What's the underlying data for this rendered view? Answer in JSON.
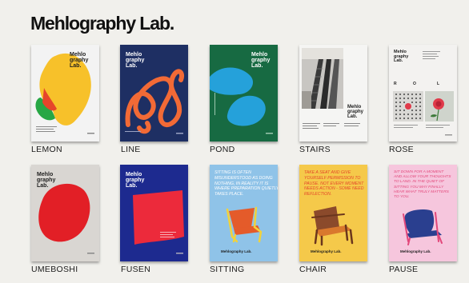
{
  "header": {
    "title": "Mehlography Lab."
  },
  "posters": [
    {
      "id": "lemon",
      "caption": "LEMON",
      "brand": "Mehlo\ngraphy\nLab.",
      "colors": {
        "bg": "#f3f3f3",
        "shape1": "#f7c12a",
        "shape2": "#e6452a",
        "shape3": "#27a745",
        "text": "#1e1e1e"
      }
    },
    {
      "id": "line",
      "caption": "LINE",
      "brand": "Mehlo\ngraphy\nLab.",
      "colors": {
        "bg": "#1e2f63",
        "shape1": "#f26a36",
        "text": "#ffffff"
      }
    },
    {
      "id": "pond",
      "caption": "POND",
      "brand": "Mehlo\ngraphy\nLab.",
      "colors": {
        "bg": "#176a42",
        "shape1": "#25a1da",
        "text": "#ffffff"
      }
    },
    {
      "id": "stairs",
      "caption": "STAIRS",
      "brand": "Mehlo\ngraphy\nLab.",
      "colors": {
        "bg": "#f5f5f3",
        "text": "#1e1e1e"
      }
    },
    {
      "id": "rose",
      "caption": "ROSE",
      "brand": "Mehlo\ngraphy\nLab.",
      "colors": {
        "bg": "#f3f2f0",
        "accent": "#e03a4a",
        "text": "#1e1e1e"
      }
    },
    {
      "id": "umeboshi",
      "caption": "UMEBOSHI",
      "brand": "Mehlo\ngraphy\nLab.",
      "colors": {
        "bg": "#d9d6d2",
        "shape1": "#e21f26",
        "text": "#1e1e1e"
      }
    },
    {
      "id": "fusen",
      "caption": "FUSEN",
      "brand": "Mehlo\ngraphy\nLab.",
      "colors": {
        "bg": "#1d2a8f",
        "shape1": "#ec2a3b",
        "text": "#ffffff"
      }
    },
    {
      "id": "sitting",
      "caption": "SITTING",
      "brand": "Mehlography Lab.",
      "text": "SITTING IS OFTEN\nMISUNDERSTOOD AS DOING\nNOTHING, IN REALITY IT IS\nWHERE PREPARATION QUIETLY\nTAKES PLACE.",
      "colors": {
        "bg": "#8fc3e8",
        "shape1": "#e45b2a",
        "shape2": "#f2d23a",
        "text": "#ffffff"
      }
    },
    {
      "id": "chair",
      "caption": "CHAIR",
      "brand": "Mehlography Lab.",
      "text": "TAKE A SEAT AND GIVE\nYOURSELF PERMISSION TO\nPAUSE. NOT EVERY MOMENT\nNEEDS ACTION - SOME NEED\nREFLECTION.",
      "colors": {
        "bg": "#f5c94a",
        "shape1": "#8b4a2b",
        "shape2": "#d9782d",
        "text": "#e4472a"
      }
    },
    {
      "id": "pause",
      "caption": "PAUSE",
      "brand": "Mehlography Lab.",
      "text": "SIT DOWN FOR A MOMENT\nAND ALLOW YOUR THOUGHTS\nTO LAND. IN THE QUIET OF\nSITTING YOU MAY FINALLY\nHEAR WHAT TRULY MATTERS\nTO YOU.",
      "colors": {
        "bg": "#f6c6dd",
        "shape1": "#2a3f8f",
        "shape2": "#e2477a",
        "text": "#e2477a"
      }
    }
  ]
}
